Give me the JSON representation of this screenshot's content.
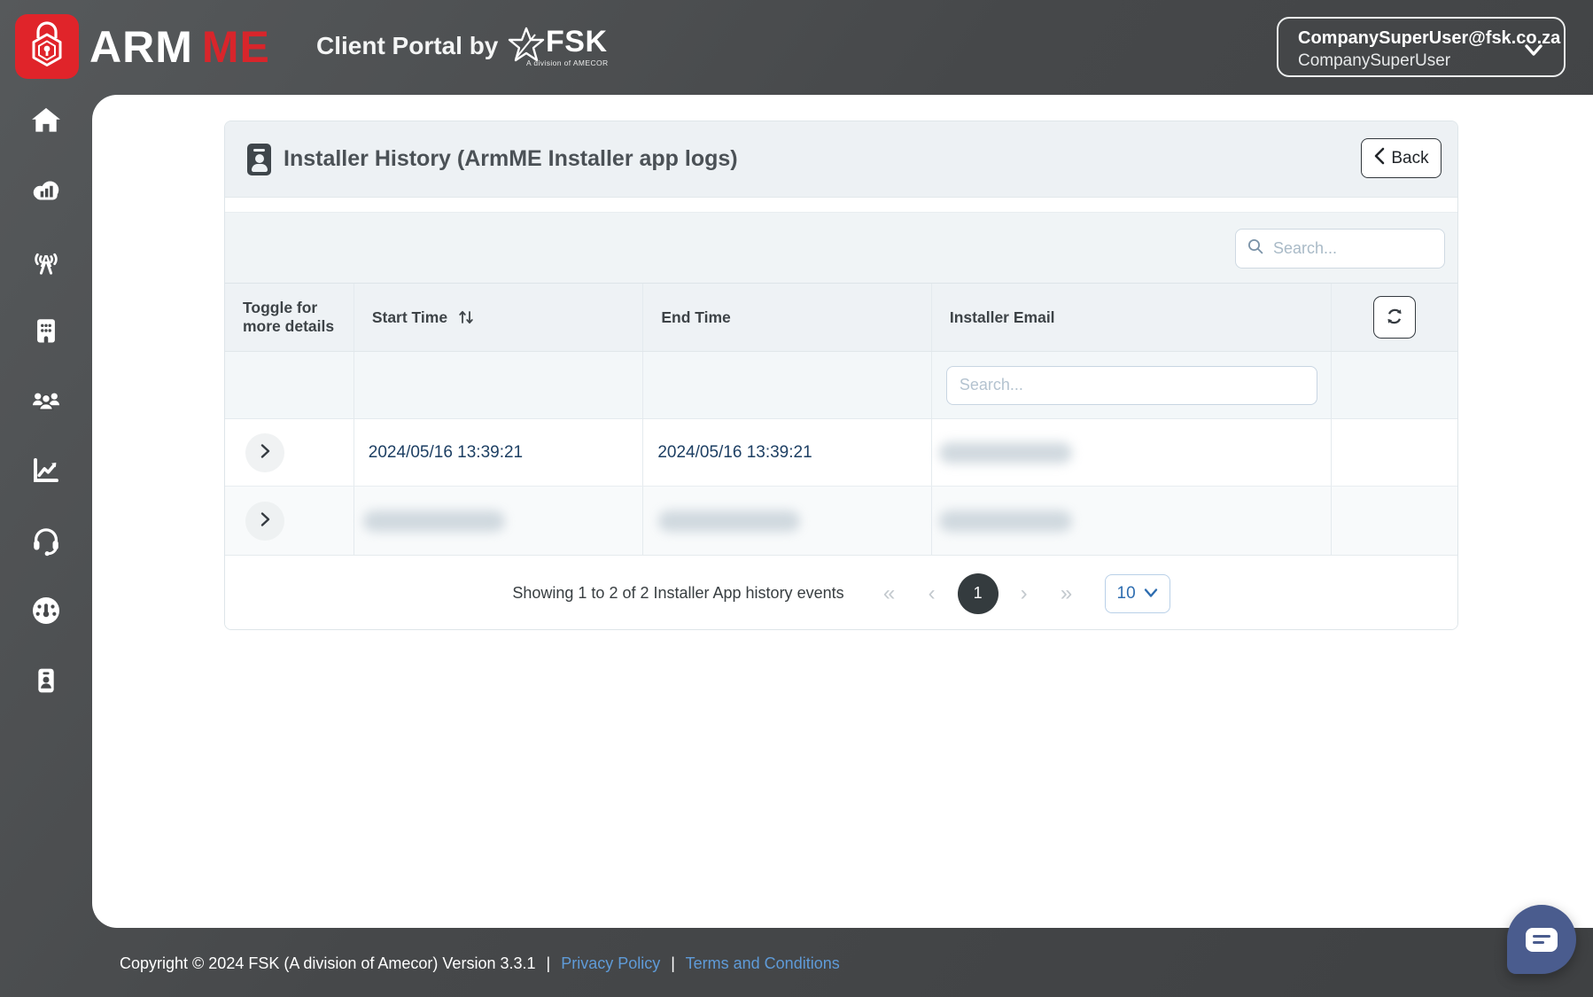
{
  "topbar": {
    "brand_arm": "ARM",
    "brand_me": "ME",
    "portal_title": "Client Portal by",
    "fsk_name": "FSK",
    "fsk_tagline": "A division of AMECOR",
    "user_email": "CompanySuperUser@fsk.co.za",
    "user_name": "CompanySuperUser"
  },
  "sidebar": {
    "items": [
      {
        "icon": "home"
      },
      {
        "icon": "cloud-stats"
      },
      {
        "icon": "broadcast-tower"
      },
      {
        "icon": "building"
      },
      {
        "icon": "users"
      },
      {
        "icon": "chart-line"
      },
      {
        "icon": "headset"
      },
      {
        "icon": "gauge"
      },
      {
        "icon": "id-badge"
      }
    ]
  },
  "card": {
    "title": "Installer History (ArmME Installer app logs)",
    "back_label": "Back",
    "search_placeholder": "Search...",
    "columns": {
      "toggle": "Toggle for more details",
      "start": "Start Time",
      "end": "End Time",
      "email": "Installer Email"
    },
    "filter_placeholder": "Search...",
    "rows": [
      {
        "start_time": "2024/05/16 13:39:21",
        "end_time": "2024/05/16 13:39:21",
        "installer_email": ""
      },
      {
        "start_time": "",
        "end_time": "",
        "installer_email": ""
      }
    ],
    "pagination": {
      "summary": "Showing 1 to 2 of 2 Installer App history events",
      "first": "«",
      "prev": "‹",
      "page": "1",
      "next": "›",
      "last": "»",
      "page_size": "10"
    }
  },
  "footer": {
    "copyright": "Copyright © 2024 FSK (A division of Amecor) Version 3.3.1",
    "separator": "|",
    "privacy": "Privacy Policy",
    "terms": "Terms and Conditions"
  },
  "colors": {
    "brand_red": "#e0242a",
    "topbar_bg": "#47494b",
    "footer_link_blue": "#5f9bd8",
    "date_link_blue": "#1d3f63",
    "active_page_bg": "#343b3e",
    "chat_fab_blue": "#4a5c8e"
  }
}
